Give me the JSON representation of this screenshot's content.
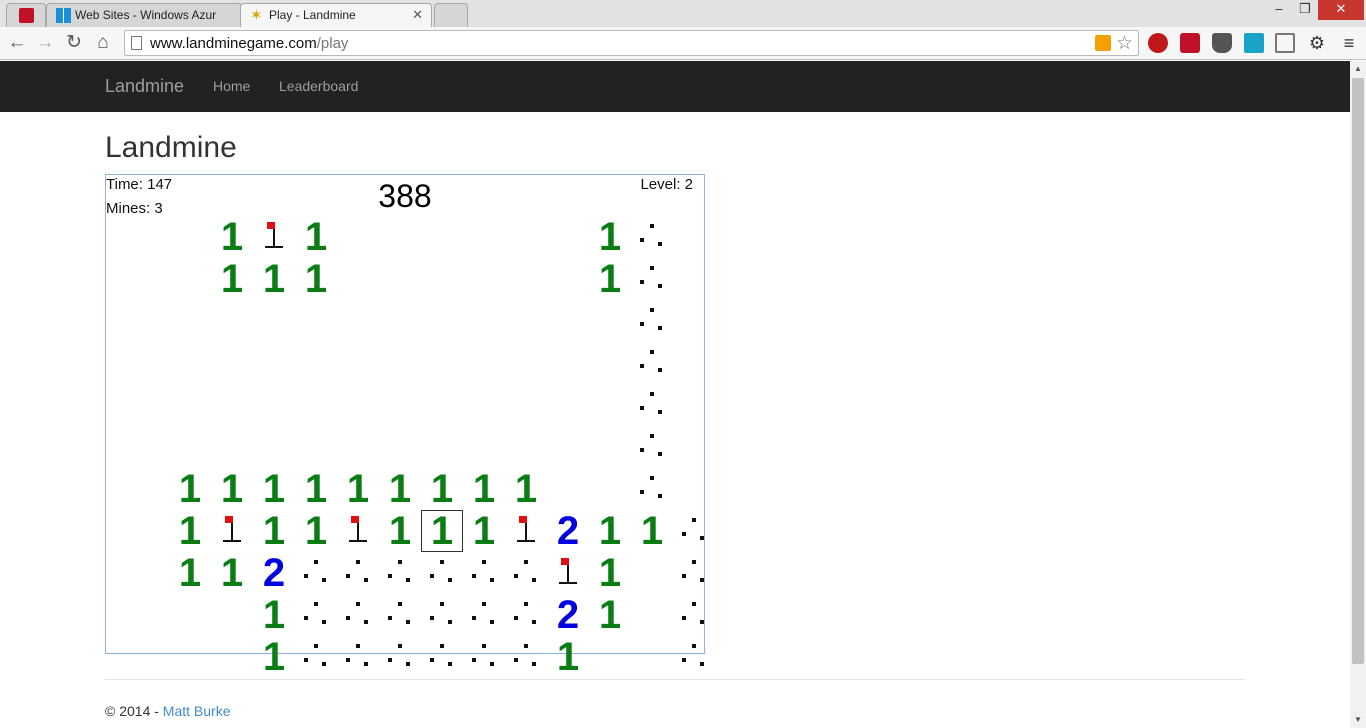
{
  "browser": {
    "tabs": [
      {
        "title": ""
      },
      {
        "title": "Web Sites - Windows Azur"
      },
      {
        "title": "Play - Landmine"
      }
    ],
    "url_host": "www.landminegame.com",
    "url_path": "/play"
  },
  "navbar": {
    "brand": "Landmine",
    "links": [
      "Home",
      "Leaderboard"
    ]
  },
  "page": {
    "title": "Landmine"
  },
  "game": {
    "time_label": "Time: 147",
    "mines_label": "Mines: 3",
    "level_label": "Level: 2",
    "score": "388",
    "cols": 14,
    "rows": 10,
    "grid": [
      "    1F1      1H",
      "    111      1H",
      "              H",
      "              H",
      "              H",
      "              H",
      "   111111111  H",
      "   1F11F1S1F211H",
      "   112HHHHHHF1 H",
      "     1HHHHHH21 H",
      "     1HHHHHH1  H"
    ],
    "selected_cell": "7,9"
  },
  "footer": {
    "copyright": "© 2014 - ",
    "author": "Matt Burke"
  },
  "colors": {
    "one": "#0b7d14",
    "two": "#0000e0",
    "flag": "#e01010",
    "navbar": "#222222",
    "board_border": "#8fb3e6"
  }
}
